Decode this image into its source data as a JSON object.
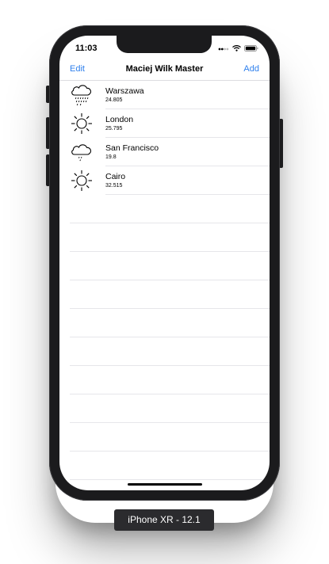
{
  "status_bar": {
    "time": "11:03",
    "icons": [
      "signal-dots-icon",
      "wifi-icon",
      "battery-icon"
    ]
  },
  "nav": {
    "left_label": "Edit",
    "title": "Maciej Wilk Master",
    "right_label": "Add"
  },
  "cities": [
    {
      "name": "Warszawa",
      "temperature": "24.805",
      "icon": "rain-cloud-icon"
    },
    {
      "name": "London",
      "temperature": "25.795",
      "icon": "sun-icon"
    },
    {
      "name": "San Francisco",
      "temperature": "19.8",
      "icon": "drizzle-cloud-icon"
    },
    {
      "name": "Cairo",
      "temperature": "32.515",
      "icon": "sun-icon"
    }
  ],
  "device_label": "iPhone XR - 12.1",
  "colors": {
    "accent": "#2f80ed",
    "frame": "#1b1b1d",
    "separator": "#e6e6ea"
  }
}
